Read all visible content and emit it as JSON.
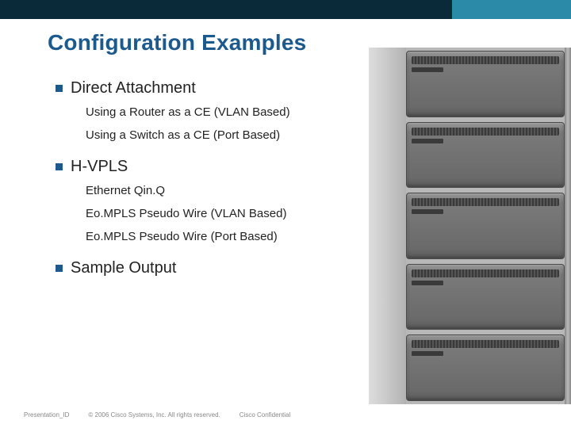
{
  "title": "Configuration Examples",
  "sections": [
    {
      "heading": "Direct Attachment",
      "subs": [
        "Using a Router as a CE (VLAN Based)",
        "Using a Switch as a CE (Port Based)"
      ]
    },
    {
      "heading": "H-VPLS",
      "subs": [
        "Ethernet Qin.Q",
        "Eo.MPLS Pseudo Wire (VLAN Based)",
        "Eo.MPLS Pseudo Wire (Port Based)"
      ]
    },
    {
      "heading": "Sample Output",
      "subs": []
    }
  ],
  "footer": {
    "presentation_id": "Presentation_ID",
    "copyright": "© 2006 Cisco Systems, Inc. All rights reserved.",
    "confidential": "Cisco Confidential"
  }
}
